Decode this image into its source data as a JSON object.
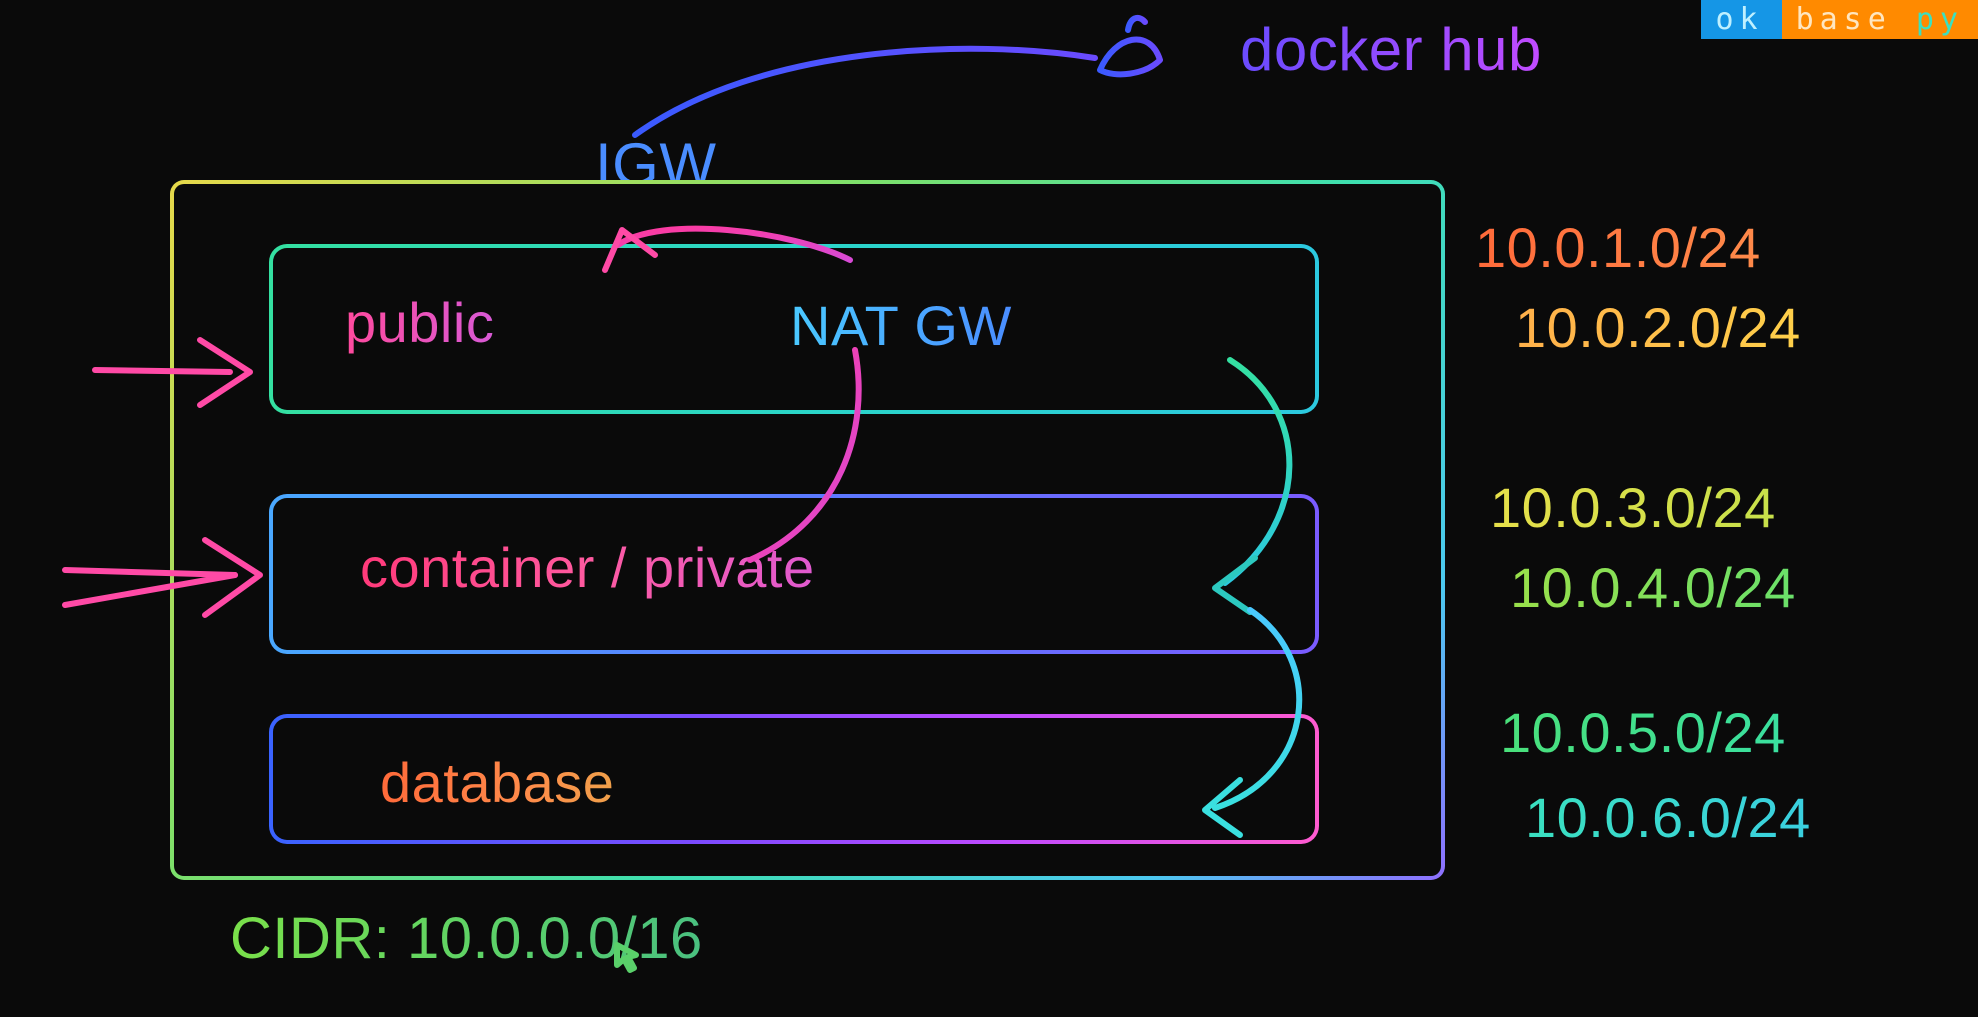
{
  "external": {
    "docker_hub": "docker hub",
    "igw": "IGW"
  },
  "vpc": {
    "cidr_label": "CIDR: 10.0.0.0/16",
    "subnets": {
      "public": {
        "label": "public",
        "nat_gw": "NAT GW",
        "cidrs": [
          "10.0.1.0/24",
          "10.0.2.0/24"
        ]
      },
      "private": {
        "label": "container / private",
        "cidrs": [
          "10.0.3.0/24",
          "10.0.4.0/24"
        ]
      },
      "database": {
        "label": "database",
        "cidrs": [
          "10.0.5.0/24",
          "10.0.6.0/24"
        ]
      }
    }
  },
  "badge": {
    "status": "ok",
    "env": "base",
    "lang": "py"
  }
}
